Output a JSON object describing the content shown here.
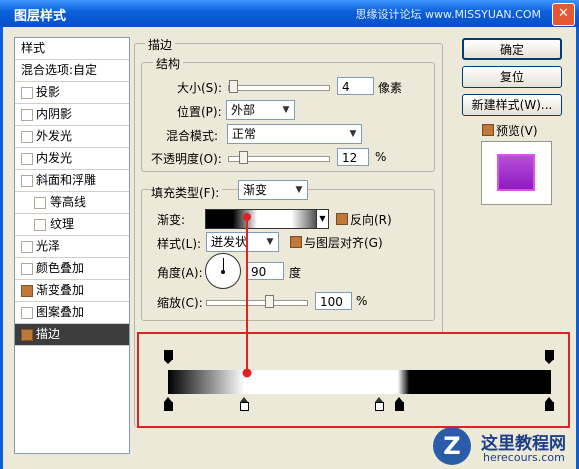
{
  "window": {
    "title": "图层样式",
    "watermark": "思缘设计论坛 www.MISSYUAN.COM",
    "close_symbol": "✕"
  },
  "sidebar": {
    "header": "样式",
    "blend_options": "混合选项:自定",
    "items": [
      {
        "label": "投影",
        "checked": false
      },
      {
        "label": "内阴影",
        "checked": false
      },
      {
        "label": "外发光",
        "checked": false
      },
      {
        "label": "内发光",
        "checked": false
      },
      {
        "label": "斜面和浮雕",
        "checked": false
      },
      {
        "label": "等高线",
        "checked": false
      },
      {
        "label": "纹理",
        "checked": false
      },
      {
        "label": "光泽",
        "checked": false
      },
      {
        "label": "颜色叠加",
        "checked": false
      },
      {
        "label": "渐变叠加",
        "checked": true
      },
      {
        "label": "图案叠加",
        "checked": false
      },
      {
        "label": "描边",
        "checked": true
      }
    ]
  },
  "stroke": {
    "group_title": "描边",
    "structure_title": "结构",
    "size_label": "大小(S):",
    "size_value": "4",
    "size_unit": "像素",
    "size_slider": 0.01,
    "position_label": "位置(P):",
    "position_value": "外部",
    "blend_label": "混合模式:",
    "blend_value": "正常",
    "opacity_label": "不透明度(O):",
    "opacity_value": "12",
    "opacity_unit": "%",
    "opacity_slider": 0.12,
    "fill_type_label": "填充类型(F):",
    "fill_type_value": "渐变",
    "gradient_label": "渐变:",
    "reverse_label": "反向(R)",
    "style_label": "样式(L):",
    "style_value": "迸发状",
    "align_label": "与图层对齐(G)",
    "angle_label": "角度(A):",
    "angle_value": "90",
    "angle_unit": "度",
    "scale_label": "缩放(C):",
    "scale_value": "100",
    "scale_unit": "%",
    "scale_slider": 0.5
  },
  "buttons": {
    "ok": "确定",
    "reset": "复位",
    "new_style": "新建样式(W)...",
    "preview": "预览(V)"
  },
  "logo": {
    "mark": "Z",
    "title": "这里教程网",
    "url": "herecours.com"
  }
}
